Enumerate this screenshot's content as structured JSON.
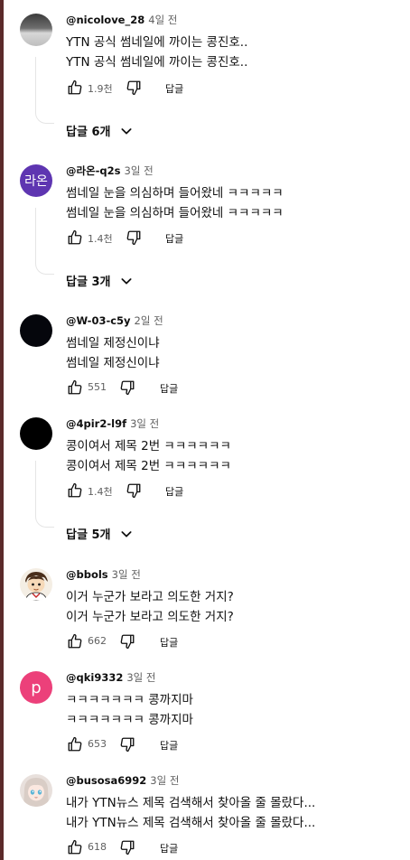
{
  "comments": [
    {
      "author": "@nicolove_28",
      "time": "4일 전",
      "lines": [
        "YTN 공식 썸네일에 까이는 콩진호..",
        "YTN 공식 썸네일에 까이는 콩진호.."
      ],
      "likes": "1.9천",
      "reply_label": "답글",
      "replies_label": "답글 6개",
      "avatar_icon": "grey-noise-avatar"
    },
    {
      "author": "@라온-q2s",
      "time": "3일 전",
      "lines": [
        "썸네일 눈을 의심하며 들어왔네 ㅋㅋㅋㅋㅋ",
        "썸네일 눈을 의심하며 들어왔네 ㅋㅋㅋㅋㅋ"
      ],
      "likes": "1.4천",
      "reply_label": "답글",
      "replies_label": "답글 3개",
      "avatar_text": "라온",
      "avatar_color": "#5e35b1"
    },
    {
      "author": "@W-03-c5y",
      "time": "2일 전",
      "lines": [
        "썸네일 제정신이냐",
        "썸네일 제정신이냐"
      ],
      "likes": "551",
      "reply_label": "답글",
      "avatar_color": "#05060c"
    },
    {
      "author": "@4pir2-l9f",
      "time": "3일 전",
      "lines": [
        "콩이여서 제목 2번 ㅋㅋㅋㅋㅋㅋ",
        "콩이여서 제목 2번 ㅋㅋㅋㅋㅋㅋ"
      ],
      "likes": "1.4천",
      "reply_label": "답글",
      "replies_label": "답글 5개",
      "avatar_color": "#000000"
    },
    {
      "author": "@bbols",
      "time": "3일 전",
      "lines": [
        "이거 누군가 보라고 의도한 거지?",
        "이거 누군가 보라고 의도한 거지?"
      ],
      "likes": "662",
      "reply_label": "답글",
      "avatar_icon": "cartoon-boy-avatar"
    },
    {
      "author": "@qki9332",
      "time": "3일 전",
      "lines": [
        "ㅋㅋㅋㅋㅋㅋㅋ 콩까지마",
        "ㅋㅋㅋㅋㅋㅋㅋ 콩까지마"
      ],
      "likes": "653",
      "reply_label": "답글",
      "avatar_text": "p",
      "avatar_color": "#ec407a"
    },
    {
      "author": "@busosa6992",
      "time": "3일 전",
      "lines": [
        "내가 YTN뉴스 제목 검색해서 찾아올 줄 몰랐다...",
        "내가 YTN뉴스 제목 검색해서 찾아올 줄 몰랐다..."
      ],
      "likes": "618",
      "reply_label": "답글",
      "avatar_icon": "anime-girl-avatar"
    }
  ],
  "icons": {
    "like": "thumb-up-icon",
    "dislike": "thumb-down-icon",
    "expand": "chevron-down-icon"
  },
  "colors": {
    "text": "#0f0f0f",
    "secondary_text": "#606060",
    "thread_line": "#e5e5e5"
  }
}
